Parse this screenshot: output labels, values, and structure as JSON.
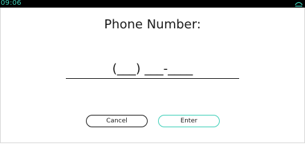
{
  "status_bar": {
    "time": "09:06",
    "icon": "eject-icon",
    "accent_color": "#3fcfb8"
  },
  "dialog": {
    "title": "Phone Number:",
    "phone_value": "(___) ___-____"
  },
  "buttons": {
    "cancel_label": "Cancel",
    "enter_label": "Enter",
    "enter_border_color": "#3fcfb8"
  }
}
